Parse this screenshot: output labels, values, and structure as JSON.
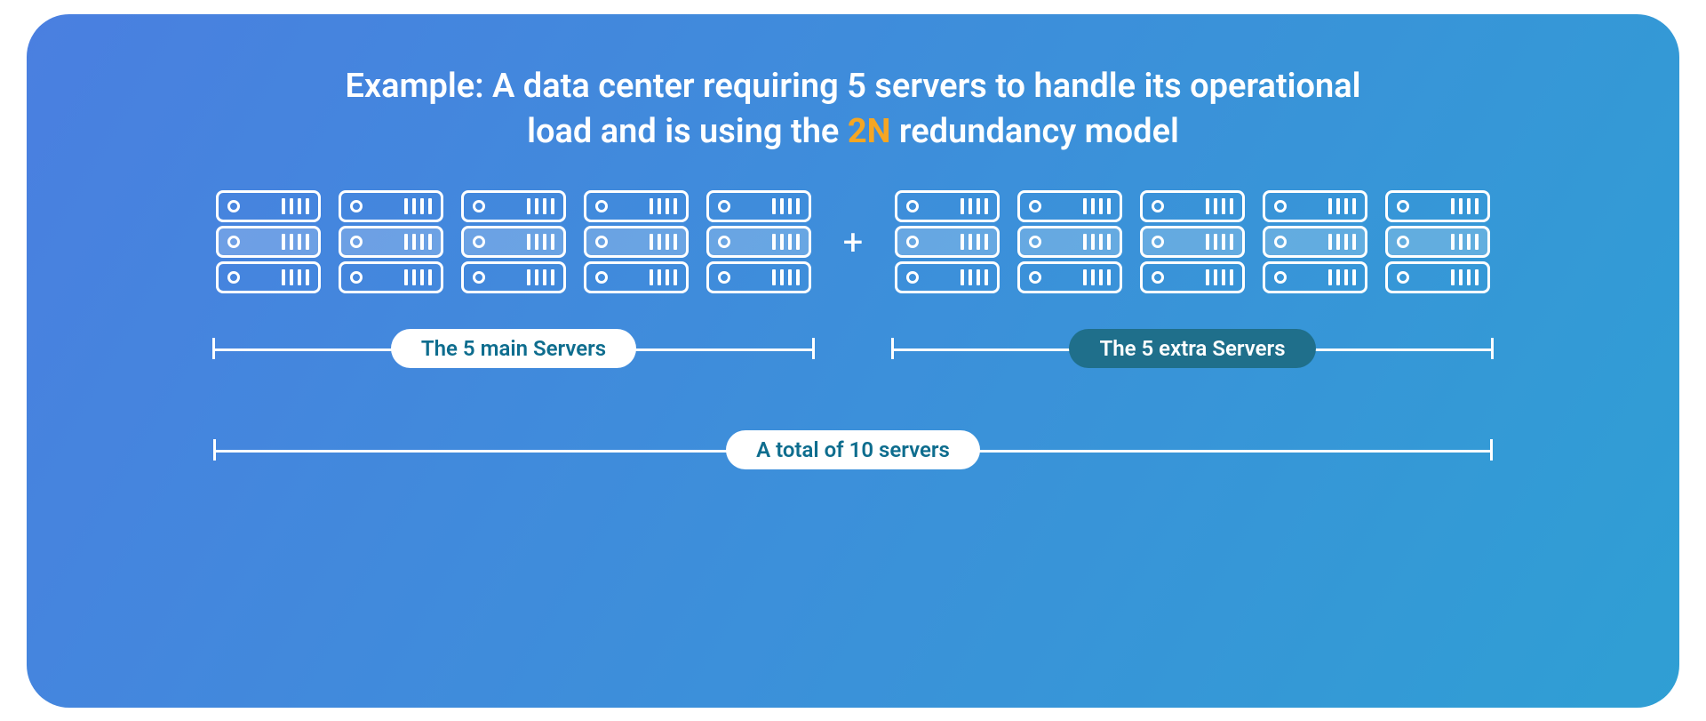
{
  "title": {
    "prefix": "Example: A data center requiring 5 servers to handle its operational load and is using the ",
    "accent": "2N",
    "suffix": " redundancy model"
  },
  "plus": "+",
  "labels": {
    "main": "The 5 main Servers",
    "extra": "The 5 extra Servers",
    "total": "A total of 10 servers"
  },
  "groups": {
    "main_count": 5,
    "extra_count": 5
  }
}
